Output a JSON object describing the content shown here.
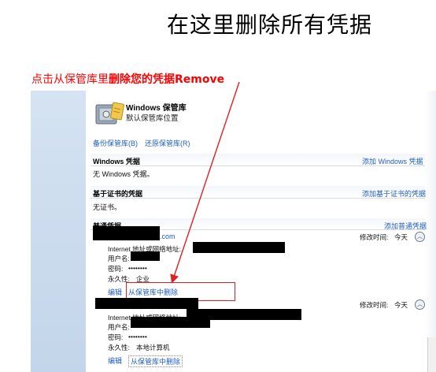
{
  "slide": {
    "title": "在这里删除所有凭据",
    "callout_prefix": "点击从保管库里",
    "callout_emphasis": "删除您的凭据Remove"
  },
  "vault": {
    "title": "Windows 保管库",
    "subtitle": "默认保管库位置",
    "icon": "vault-safe-icon"
  },
  "actions": {
    "backup": "备份保管库(B)",
    "restore": "还原保管库(R)"
  },
  "sections": {
    "windows": {
      "title": "Windows 凭据",
      "add": "添加 Windows 凭据",
      "empty": "无 Windows 凭据。"
    },
    "cert": {
      "title": "基于证书的凭据",
      "add": "添加基于证书的凭据",
      "empty": "无证书。"
    },
    "generic": {
      "title": "普通凭据",
      "add": "添加普通凭据"
    }
  },
  "credentials": [
    {
      "name_suffix": ".com",
      "modified_label": "修改时间:",
      "modified_value": "今天",
      "address_label": "Internet 地址或网络地址:",
      "user_label": "用户名:",
      "password_label": "密码:",
      "password_value": "••••••••",
      "persistence_label": "永久性:",
      "persistence_value": "企业",
      "edit": "编辑",
      "remove": "从保管库中删除"
    },
    {
      "modified_label": "修改时间:",
      "modified_value": "今天",
      "address_label": "Internet 地址或网络地址:",
      "user_label": "用户名:",
      "password_label": "密码:",
      "password_value": "••••••••",
      "persistence_label": "永久性:",
      "persistence_value": "本地计算机",
      "edit": "编辑",
      "remove": "从保管库中删除"
    }
  ],
  "colors": {
    "link": "#1f5fbf",
    "callout": "#ff0000",
    "highlight": "#e02020"
  }
}
